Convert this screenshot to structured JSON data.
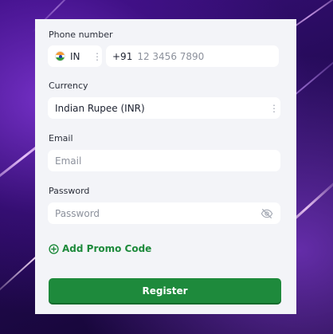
{
  "form": {
    "phone": {
      "label": "Phone number",
      "country_code": "IN",
      "dial_prefix": "+91",
      "placeholder": "12 3456 7890"
    },
    "currency": {
      "label": "Currency",
      "value": "Indian Rupee (INR)"
    },
    "email": {
      "label": "Email",
      "placeholder": "Email"
    },
    "password": {
      "label": "Password",
      "placeholder": "Password"
    },
    "promo_link": "Add Promo Code",
    "register_button": "Register"
  },
  "icons": {
    "country_flag": "india-flag-icon",
    "country_menu": "kebab-menu-icon",
    "currency_menu": "kebab-menu-icon",
    "password_toggle": "eye-slash-icon",
    "promo": "plus-circle-icon"
  },
  "colors": {
    "accent": "#1e8a3c",
    "card_background": "#f3f4f8",
    "page_background": "#2a0b57"
  }
}
